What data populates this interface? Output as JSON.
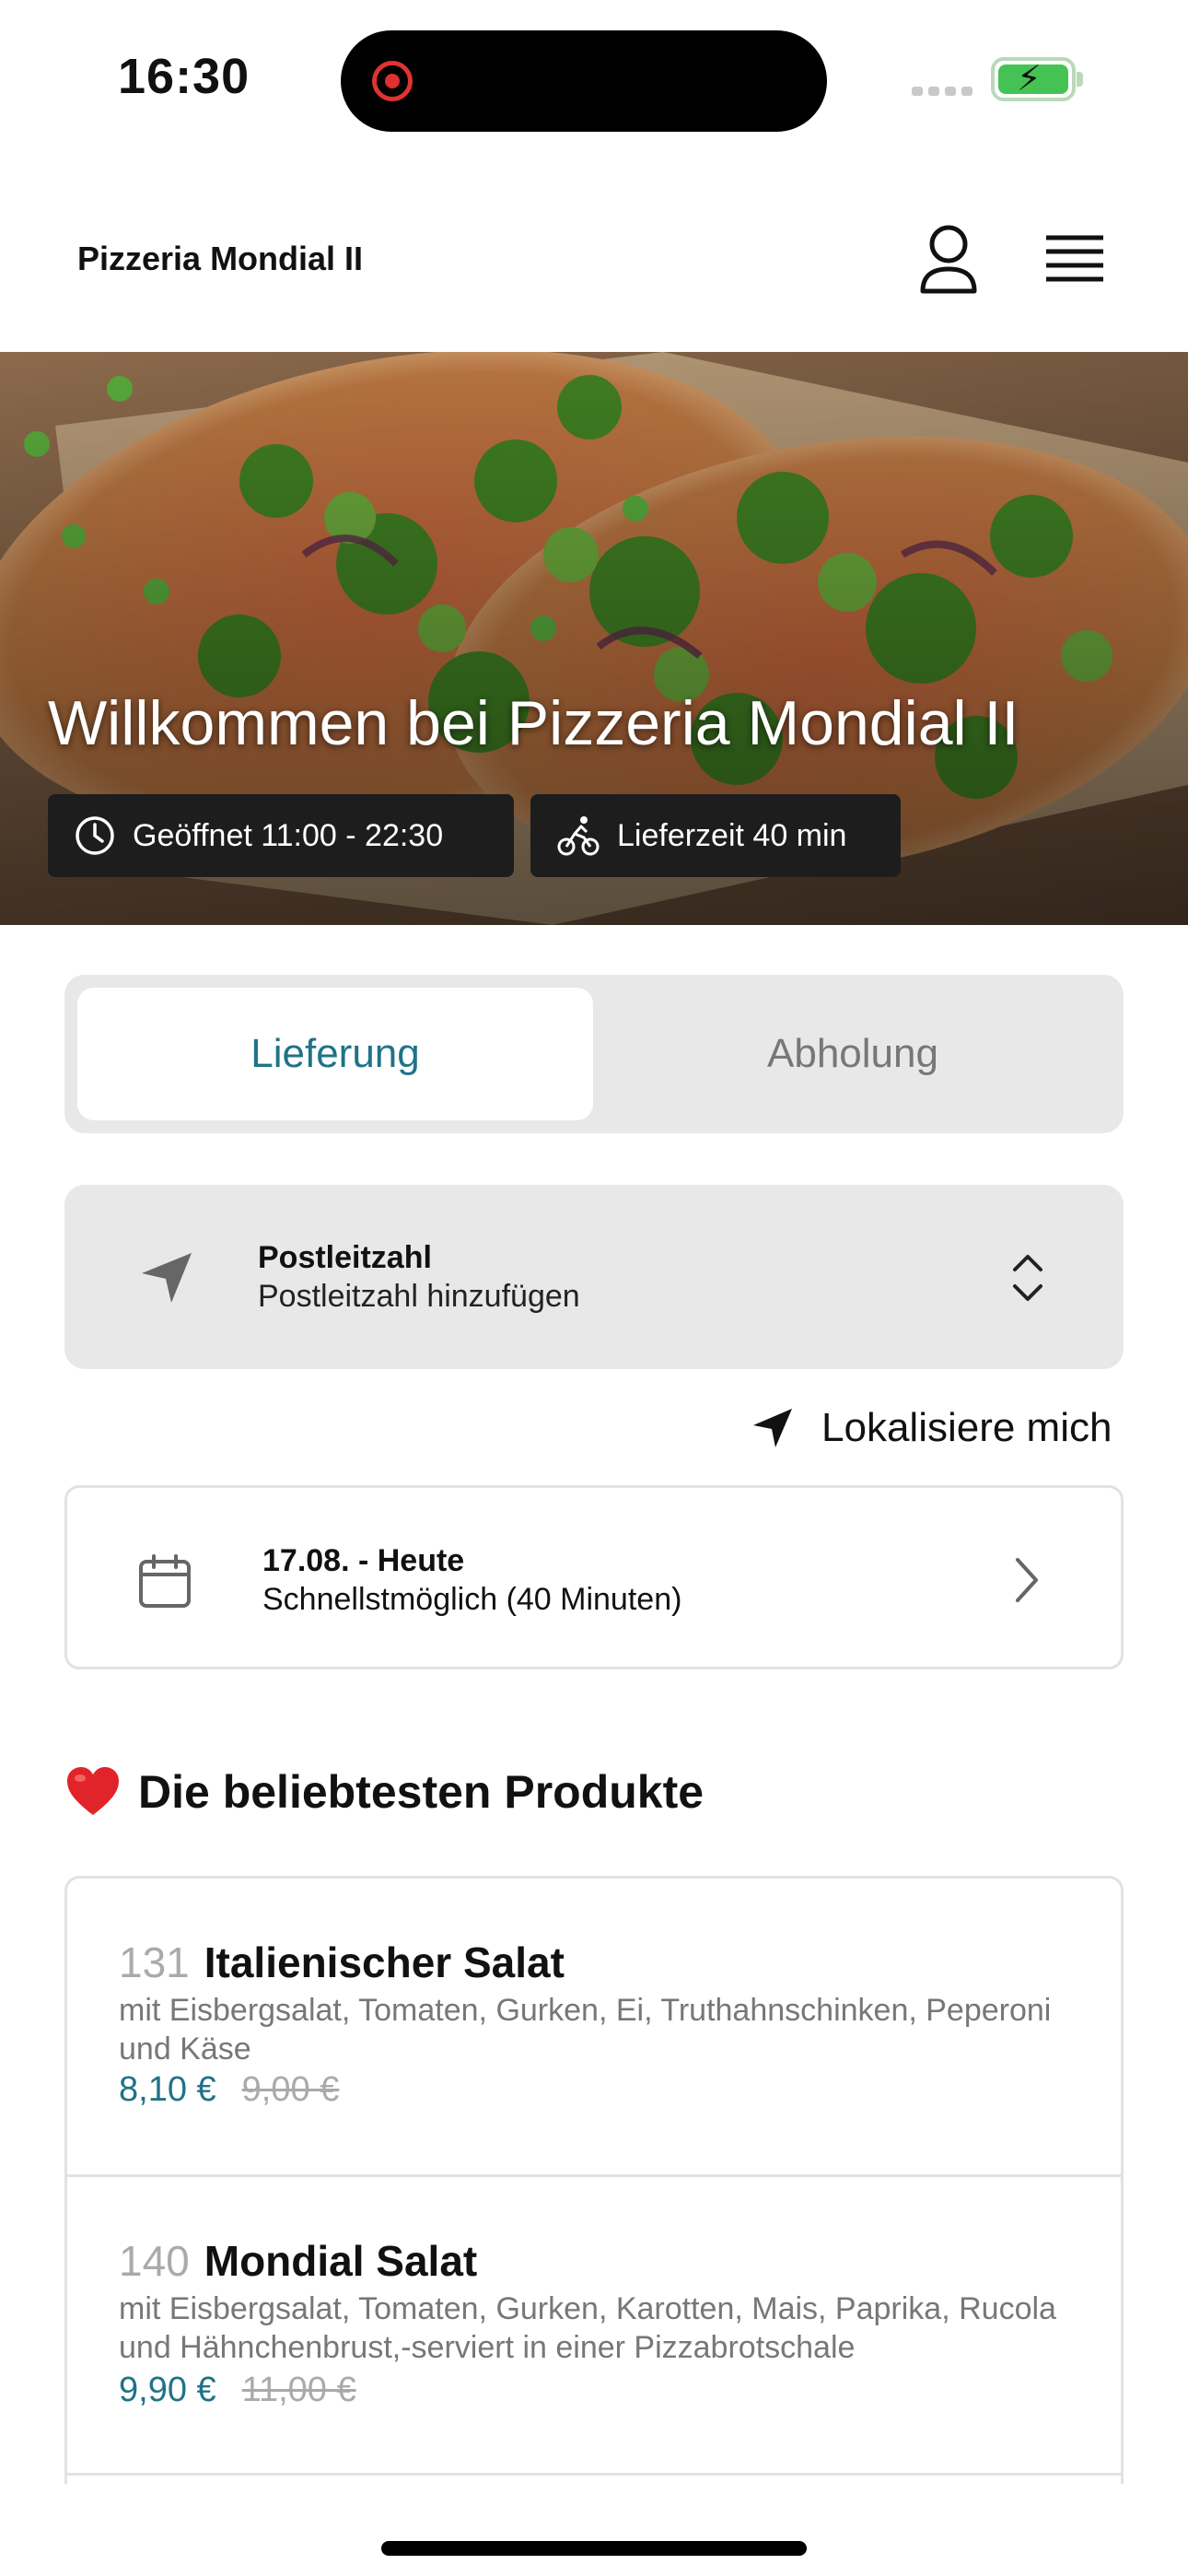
{
  "status_bar": {
    "time": "16:30"
  },
  "header": {
    "brand": "Pizzeria Mondial II"
  },
  "hero": {
    "title": "Willkommen bei Pizzeria Mondial II",
    "opening_hours": "Geöffnet 11:00 - 22:30",
    "delivery_time": "Lieferzeit 40 min"
  },
  "mode_toggle": {
    "delivery_label": "Lieferung",
    "pickup_label": "Abholung",
    "selected": "Lieferung"
  },
  "postcode": {
    "title": "Postleitzahl",
    "placeholder": "Postleitzahl hinzufügen"
  },
  "locate": {
    "label": "Lokalisiere mich"
  },
  "schedule": {
    "date": "17.08. - Heute",
    "time": "Schnellstmöglich (40 Minuten)"
  },
  "popular": {
    "title": "Die beliebtesten Produkte",
    "items": [
      {
        "number": "131",
        "name": "Italienischer Salat",
        "description": "mit Eisbergsalat, Tomaten, Gurken, Ei, Truthahnschinken, Peperoni und Käse",
        "price": "8,10 €",
        "old_price": "9,00 €"
      },
      {
        "number": "140",
        "name": "Mondial Salat",
        "description": "mit Eisbergsalat, Tomaten, Gurken, Karotten, Mais, Paprika, Rucola und Hähnchenbrust,-serviert in einer Pizzabrotschale",
        "price": "9,90 €",
        "old_price": "11,00 €"
      }
    ]
  },
  "colors": {
    "accent": "#1f7388",
    "panel": "#e8e8e8",
    "badge": "#1d1d1d"
  }
}
